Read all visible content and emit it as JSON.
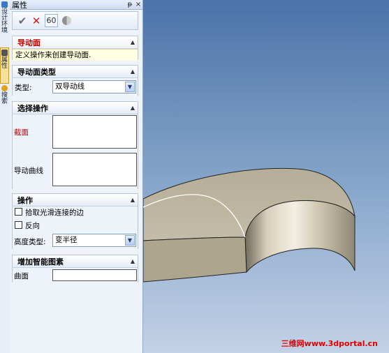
{
  "vertical_tabs": {
    "design": "设计环境",
    "properties": "属性",
    "help": "搜索"
  },
  "panel": {
    "title": "属性",
    "pin_glyph": "ᵽ",
    "close_glyph": "×"
  },
  "toolbar": {
    "ok_glyph": "✔",
    "cancel_glyph": "✕",
    "preview_glyph": "60"
  },
  "guide": {
    "title": "导动面",
    "message": "定义操作来创建导动面."
  },
  "guide_type": {
    "title": "导动面类型",
    "type_label": "类型:",
    "type_value": "双导动线"
  },
  "select_ops": {
    "title": "选择操作",
    "section_label": "截面",
    "curve_label": "导动曲线"
  },
  "ops": {
    "title": "操作",
    "pick_tangent_label": "拾取光滑连接的边",
    "reverse_label": "反向",
    "height_type_label": "高度类型:",
    "height_type_value": "变半径"
  },
  "smart": {
    "title": "增加智能图素",
    "surface_label": "曲面"
  },
  "collapse_glyph": "▲",
  "dropdown_glyph": "▼",
  "watermark": "三维网www.3dportal.cn"
}
